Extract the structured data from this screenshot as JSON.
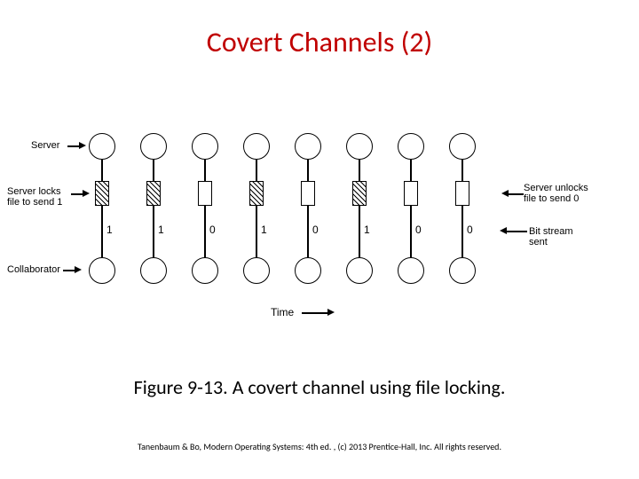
{
  "title": "Covert Channels (2)",
  "caption": "Figure 9-13. A covert channel using file locking.",
  "copyright": "Tanenbaum & Bo, Modern Operating Systems: 4th ed. , (c) 2013 Prentice-Hall, Inc. All rights reserved.",
  "labels": {
    "server": "Server",
    "server_locks": "Server locks\nfile to send 1",
    "collaborator": "Collaborator",
    "server_unlocks": "Server unlocks\nfile to send 0",
    "bit_stream": "Bit stream sent",
    "time": "Time"
  },
  "bits": [
    "1",
    "1",
    "0",
    "1",
    "0",
    "1",
    "0",
    "0"
  ],
  "locked": [
    true,
    true,
    false,
    true,
    false,
    true,
    false,
    false
  ]
}
